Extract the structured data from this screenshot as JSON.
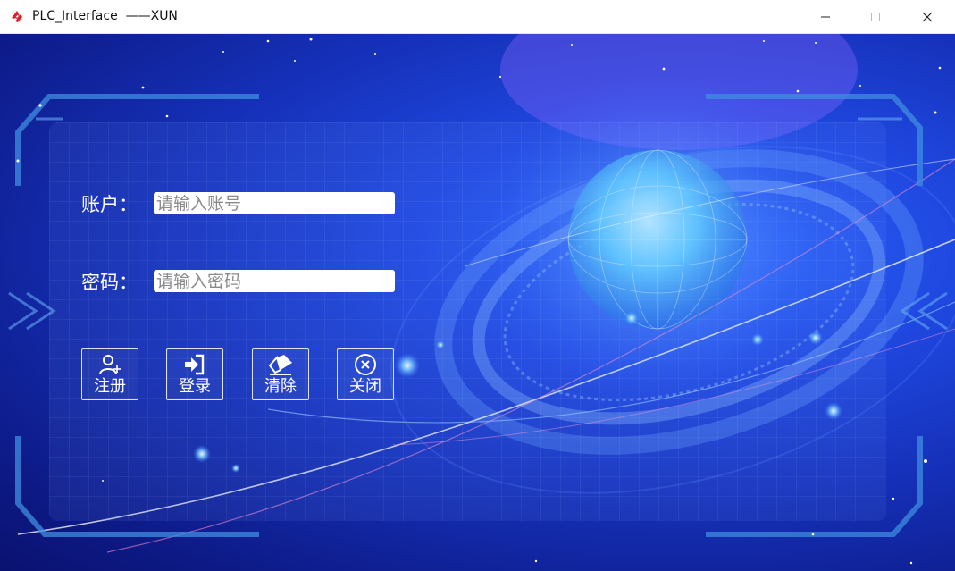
{
  "window": {
    "title": "PLC_Interface  ——XUN"
  },
  "form": {
    "account_label": "账户：",
    "account_placeholder": "请输入账号",
    "account_value": "",
    "password_label": "密码：",
    "password_placeholder": "请输入密码",
    "password_value": ""
  },
  "actions": [
    {
      "label": "注册",
      "icon": "user-add-icon"
    },
    {
      "label": "登录",
      "icon": "login-icon"
    },
    {
      "label": "清除",
      "icon": "eraser-icon"
    },
    {
      "label": "关闭",
      "icon": "close-circle-icon"
    }
  ],
  "colors": {
    "background_dark": "#0d1a86",
    "background_mid": "#1f48e0",
    "accent_glow": "#5ec8ff",
    "frame": "#3f8ee0"
  }
}
